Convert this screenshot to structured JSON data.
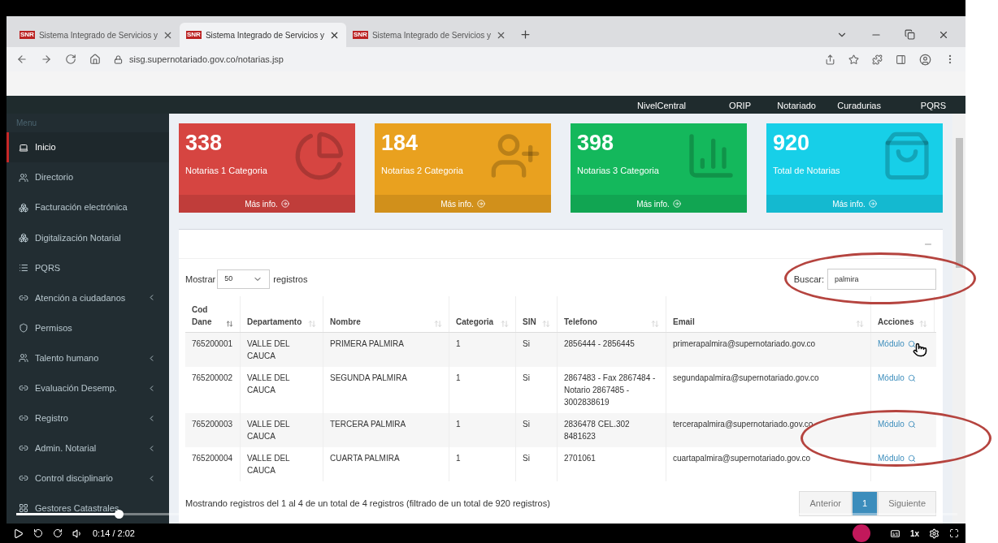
{
  "browser": {
    "tabs": [
      {
        "favicon": "SNR",
        "title": "Sistema Integrado de Servicios y",
        "selected": false
      },
      {
        "favicon": "SNR",
        "title": "Sistema Integrado de Servicios y",
        "selected": true
      },
      {
        "favicon": "SNR",
        "title": "Sistema Integrado de Servicios y",
        "selected": false
      }
    ],
    "url": "sisg.supernotariado.gov.co/notarias.jsp"
  },
  "top_nav": [
    "NivelCentral",
    "ORIP",
    "Notariado",
    "Curadurias",
    "PQRS"
  ],
  "sidebar": {
    "heading": "Menu",
    "items": [
      {
        "label": "Inicio",
        "selected": true,
        "submenu": false
      },
      {
        "label": "Directorio",
        "selected": false,
        "submenu": false
      },
      {
        "label": "Facturación electrónica",
        "selected": false,
        "submenu": false
      },
      {
        "label": "Digitalización Notarial",
        "selected": false,
        "submenu": false
      },
      {
        "label": "PQRS",
        "selected": false,
        "submenu": false
      },
      {
        "label": "Atención a ciudadanos",
        "selected": false,
        "submenu": true
      },
      {
        "label": "Permisos",
        "selected": false,
        "submenu": false
      },
      {
        "label": "Talento humano",
        "selected": false,
        "submenu": true
      },
      {
        "label": "Evaluación Desemp.",
        "selected": false,
        "submenu": true
      },
      {
        "label": "Registro",
        "selected": false,
        "submenu": true
      },
      {
        "label": "Admin. Notarial",
        "selected": false,
        "submenu": true
      },
      {
        "label": "Control disciplinario",
        "selected": false,
        "submenu": true
      },
      {
        "label": "Gestores Catastrales",
        "selected": false,
        "submenu": false
      }
    ]
  },
  "stat_cards": [
    {
      "value": "338",
      "label": "Notarias 1 Categoria",
      "link": "Más info.",
      "color": "#d64541"
    },
    {
      "value": "184",
      "label": "Notarias 2 Categoria",
      "link": "Más info.",
      "color": "#e9a11f"
    },
    {
      "value": "398",
      "label": "Notarias 3 Categoria",
      "link": "Más info.",
      "color": "#14b85c"
    },
    {
      "value": "920",
      "label": "Total de Notarias",
      "link": "Más info.",
      "color": "#17cfe8"
    }
  ],
  "table_panel": {
    "show_label": "Mostrar",
    "page_size": "50",
    "show_suffix": "registros",
    "search_label": "Buscar:",
    "search_value": "palmira",
    "columns": [
      {
        "label": "Cod Dane",
        "sorted": true
      },
      {
        "label": "Departamento",
        "sorted": false
      },
      {
        "label": "Nombre",
        "sorted": false
      },
      {
        "label": "Categoria",
        "sorted": false
      },
      {
        "label": "SIN",
        "sorted": false
      },
      {
        "label": "Telefono",
        "sorted": false
      },
      {
        "label": "Email",
        "sorted": false
      },
      {
        "label": "Acciones",
        "sorted": false
      }
    ],
    "rows": [
      {
        "cod_dane": "765200001",
        "departamento": "VALLE DEL CAUCA",
        "nombre": "PRIMERA PALMIRA",
        "categoria": "1",
        "sin": "Si",
        "telefono": "2856444 - 2856445",
        "email": "primerapalmira@supernotariado.gov.co",
        "accion": "Módulo"
      },
      {
        "cod_dane": "765200002",
        "departamento": "VALLE DEL CAUCA",
        "nombre": "SEGUNDA PALMIRA",
        "categoria": "1",
        "sin": "Si",
        "telefono": "2867483 - Fax 2867484 - Notario 2867485 - 3002838619",
        "email": "segundapalmira@supernotariado.gov.co",
        "accion": "Módulo"
      },
      {
        "cod_dane": "765200003",
        "departamento": "VALLE DEL CAUCA",
        "nombre": "TERCERA PALMIRA",
        "categoria": "1",
        "sin": "Si",
        "telefono": "2836478 CEL.302 8481623",
        "email": "tercerapalmira@supernotariado.gov.co",
        "accion": "Módulo"
      },
      {
        "cod_dane": "765200004",
        "departamento": "VALLE DEL CAUCA",
        "nombre": "CUARTA PALMIRA",
        "categoria": "1",
        "sin": "Si",
        "telefono": "2701061",
        "email": "cuartapalmira@supernotariado.gov.co",
        "accion": "Módulo"
      }
    ],
    "info": "Mostrando registros del 1 al 4 de un total de 4 registros (filtrado de un total de 920 registros)",
    "pagination": [
      {
        "label": "Anterior",
        "selected": false
      },
      {
        "label": "1",
        "selected": true
      },
      {
        "label": "Siguiente",
        "selected": false
      }
    ]
  },
  "video_player": {
    "time": "0:14 / 2:02",
    "level": 0.11,
    "speed": "1x"
  }
}
